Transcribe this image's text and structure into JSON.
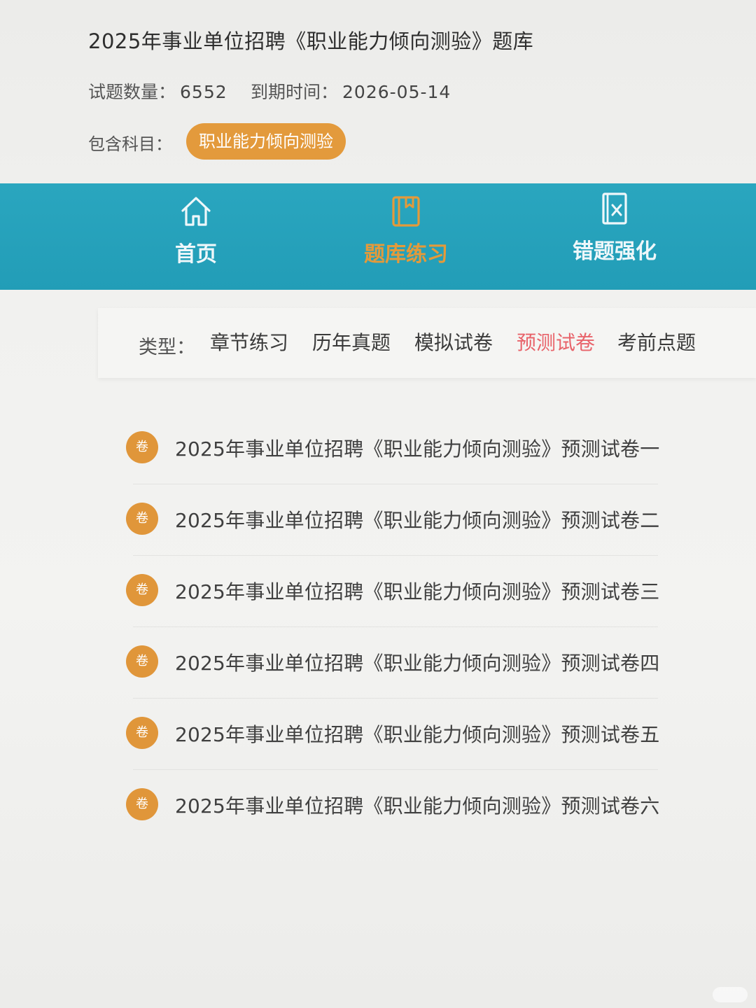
{
  "header": {
    "title": "2025年事业单位招聘《职业能力倾向测验》题库",
    "count_label": "试题数量：",
    "count_value": "6552",
    "expire_label": "到期时间：",
    "expire_value": "2026-05-14",
    "subject_label": "包含科目：",
    "subject_pill": "职业能力倾向测验"
  },
  "nav": {
    "items": [
      {
        "label": "首页",
        "icon": "home-icon"
      },
      {
        "label": "题库练习",
        "icon": "book-icon",
        "active": true
      },
      {
        "label": "错题强化",
        "icon": "wrong-doc-icon"
      }
    ]
  },
  "filter": {
    "label": "类型：",
    "options": [
      "章节练习",
      "历年真题",
      "模拟试卷",
      "预测试卷",
      "考前点题"
    ],
    "active": "预测试卷"
  },
  "papers": {
    "badge": "卷",
    "items": [
      "2025年事业单位招聘《职业能力倾向测验》预测试卷一",
      "2025年事业单位招聘《职业能力倾向测验》预测试卷二",
      "2025年事业单位招聘《职业能力倾向测验》预测试卷三",
      "2025年事业单位招聘《职业能力倾向测验》预测试卷四",
      "2025年事业单位招聘《职业能力倾向测验》预测试卷五",
      "2025年事业单位招聘《职业能力倾向测验》预测试卷六"
    ]
  },
  "colors": {
    "accent_orange": "#e39a3c",
    "nav_teal": "#27a3bc",
    "active_red": "#e8636a"
  }
}
